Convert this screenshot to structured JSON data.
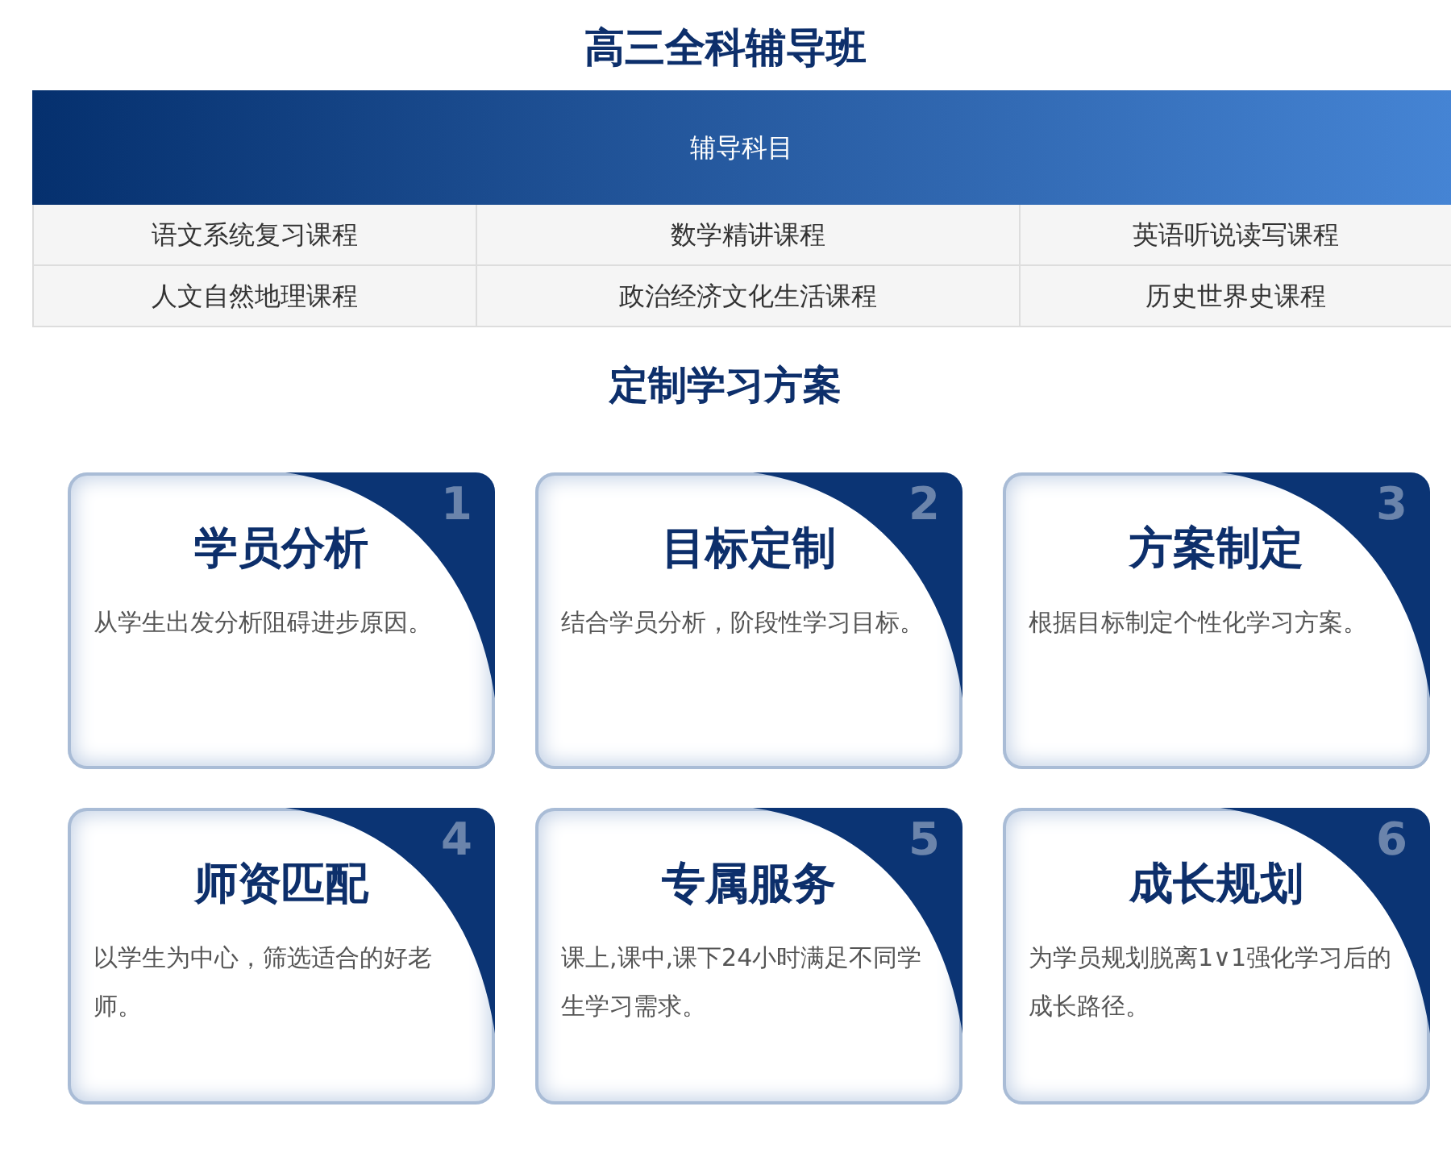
{
  "title": "高三全科辅导班",
  "subjects": {
    "header": "辅导科目",
    "rows": [
      [
        "语文系统复习课程",
        "数学精讲课程",
        "英语听说读写课程"
      ],
      [
        "人文自然地理课程",
        "政治经济文化生活课程",
        "历史世界史课程"
      ]
    ]
  },
  "plan": {
    "title": "定制学习方案",
    "cards": [
      {
        "number": "1",
        "title": "学员分析",
        "text": "从学生出发分析阻碍进步原因。"
      },
      {
        "number": "2",
        "title": "目标定制",
        "text": "结合学员分析，阶段性学习目标。"
      },
      {
        "number": "3",
        "title": "方案制定",
        "text": "根据目标制定个性化学习方案。"
      },
      {
        "number": "4",
        "title": "师资匹配",
        "text": "以学生为中心，筛选适合的好老师。"
      },
      {
        "number": "5",
        "title": "专属服务",
        "text": "课上,课中,课下24小时满足不同学生学习需求。"
      },
      {
        "number": "6",
        "title": "成长规划",
        "text": "为学员规划脱离1∨1强化学习后的成长路径。"
      }
    ]
  }
}
